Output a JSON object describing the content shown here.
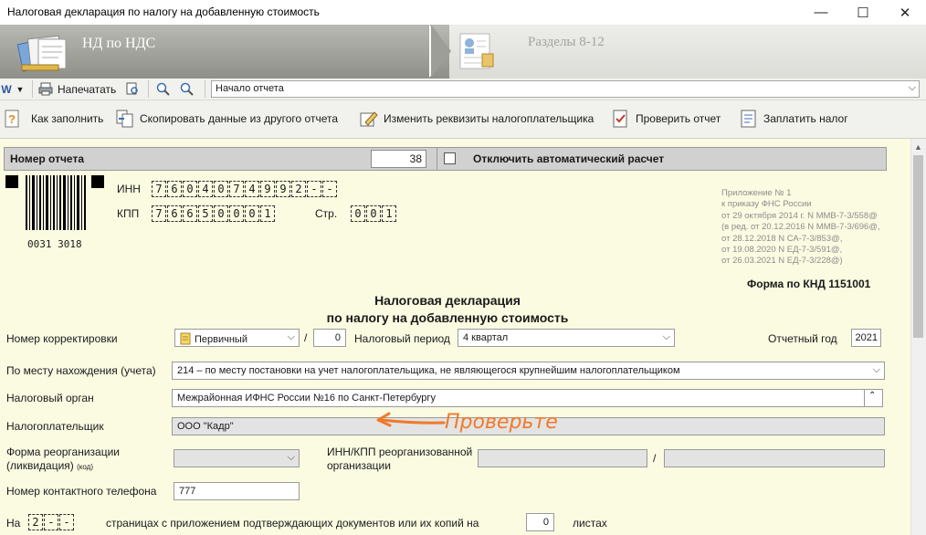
{
  "window": {
    "title": "Налоговая декларация по налогу на добавленную стоимость",
    "minimize_glyph": "—",
    "maximize_glyph": "☐",
    "close_glyph": "✕"
  },
  "steps": [
    {
      "label": "НД по НДС",
      "active": true
    },
    {
      "label": "Разделы 8-12",
      "active": false
    }
  ],
  "toolbar1": {
    "print_label": "Напечатать",
    "nav_selected": "Начало отчета"
  },
  "toolbar2": {
    "buttons": [
      {
        "label": "Как заполнить",
        "icon": "help-icon"
      },
      {
        "label": "Скопировать данные из другого отчета",
        "icon": "copy-icon"
      },
      {
        "label": "Изменить реквизиты налогоплательщика",
        "icon": "edit-icon"
      },
      {
        "label": "Проверить отчет",
        "icon": "check-icon"
      },
      {
        "label": "Заплатить налог",
        "icon": "pay-icon"
      }
    ]
  },
  "report": {
    "number_label": "Номер отчета",
    "number_value": "38",
    "auto_calc_label": "Отключить автоматический расчет",
    "auto_calc_checked": false
  },
  "header": {
    "barcode_number": "0031 3018",
    "inn_label": "ИНН",
    "inn_cells": [
      "7",
      "6",
      "0",
      "4",
      "0",
      "7",
      "4",
      "9",
      "9",
      "2",
      "-",
      "-"
    ],
    "kpp_label": "КПП",
    "kpp_cells": [
      "7",
      "6",
      "6",
      "5",
      "0",
      "0",
      "0",
      "1"
    ],
    "page_label": "Стр.",
    "page_cells": [
      "0",
      "0",
      "1"
    ],
    "appendix_lines": [
      "Приложение № 1",
      "к приказу ФНС России",
      "от 29 октября 2014 г. N ММВ-7-3/558@",
      "(в ред. от 20.12.2016 N ММВ-7-3/696@,",
      "от 28.12.2018 N СА-7-3/853@,",
      "от 19.08.2020 N ЕД-7-3/591@,",
      "от 26.03.2021 N ЕД-7-3/228@)"
    ],
    "form_knd": "Форма по КНД 1151001",
    "title_line1": "Налоговая декларация",
    "title_line2": "по налогу на добавленную стоимость"
  },
  "fields": {
    "correction_label": "Номер корректировки",
    "correction_type": "Первичный",
    "correction_slash": "/",
    "correction_number": "0",
    "period_label": "Налоговый период",
    "period_value": "4 квартал",
    "year_label": "Отчетный год",
    "year_value": "2021",
    "location_label": "По месту нахождения (учета)",
    "location_value": "214 – по месту постановки на учет налогоплательщика, не являющегося крупнейшим налогоплательщиком",
    "tax_authority_label": "Налоговый орган",
    "tax_authority_value": "Межрайонная ИФНС России №16 по Санкт-Петербургу",
    "taxpayer_label": "Налогоплательщик",
    "taxpayer_value": "ООО \"Кадр\"",
    "reorg_label_line1": "Форма реорганизации",
    "reorg_label_line2": "(ликвидация)",
    "reorg_code": "(код)",
    "reorg_value": "",
    "reorg_inn_label_line1": "ИНН/КПП реорганизованной",
    "reorg_inn_label_line2": "организации",
    "reorg_inn_value": "",
    "reorg_inn_slash": "/",
    "reorg_kpp_value": "",
    "phone_label": "Номер контактного телефона",
    "phone_value": "777",
    "pages_prefix": "На",
    "pages_cells": [
      "2",
      "-",
      "-"
    ],
    "pages_text": "страницах с приложением подтверждающих документов или их копий на",
    "sheets_value": "0",
    "sheets_label": "листах"
  },
  "annotation": {
    "text": "Проверьте",
    "color": "#f07a2a"
  }
}
